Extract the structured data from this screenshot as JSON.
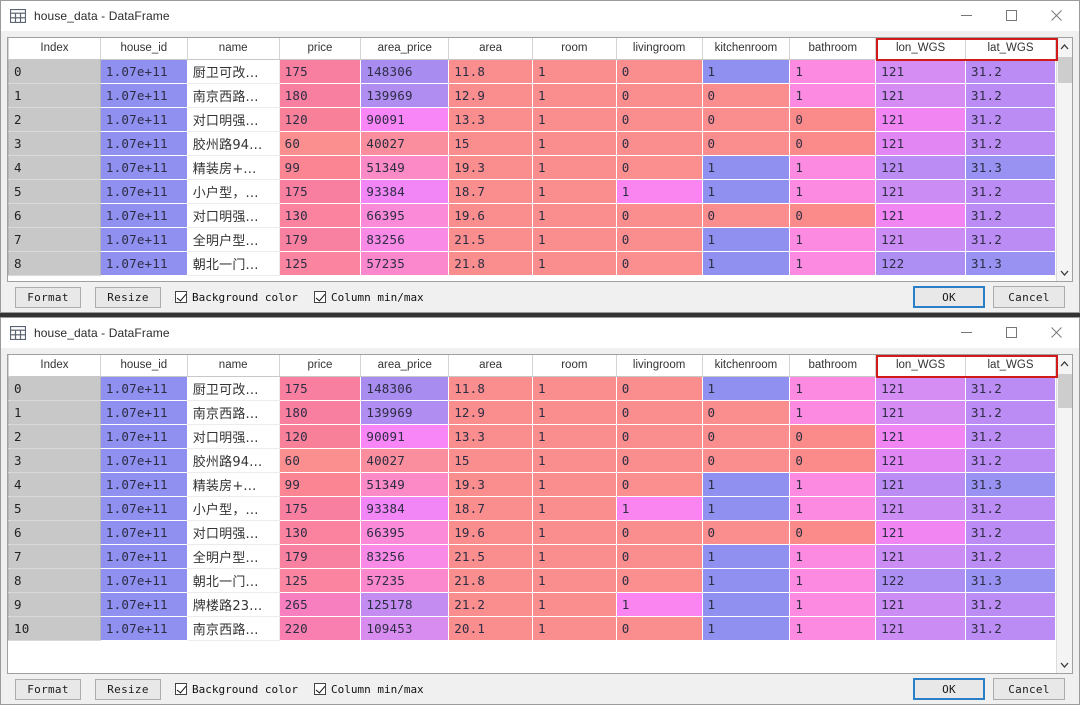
{
  "window": {
    "title": "house_data - DataFrame",
    "icon": "table-icon",
    "controls": {
      "minimize": "—",
      "maximize": "□",
      "close": "✕"
    }
  },
  "footer": {
    "format_label": "Format",
    "resize_label": "Resize",
    "background_color_label": "Background color",
    "column_minmax_label": "Column min/max",
    "background_color_checked": true,
    "column_minmax_checked": true,
    "ok_label": "OK",
    "cancel_label": "Cancel"
  },
  "highlight": {
    "color": "#d11b1b",
    "columns": [
      "lon_WGS",
      "lat_WGS"
    ]
  },
  "table": {
    "columns": [
      "Index",
      "house_id",
      "name",
      "price",
      "area_price",
      "area",
      "room",
      "livingroom",
      "kitchenroom",
      "bathroom",
      "lon_WGS",
      "lat_WGS"
    ],
    "rows": [
      {
        "Index": "0",
        "house_id": "1.07e+11",
        "name": "厨卫可改...",
        "price": "175",
        "area_price": "148306",
        "area": "11.8",
        "room": "1",
        "livingroom": "0",
        "kitchenroom": "1",
        "bathroom": "1",
        "lon_WGS": "121",
        "lat_WGS": "31.2",
        "colors": {
          "house_id": "#8f90f0",
          "price": "#f87fa0",
          "area_price": "#a88cf0",
          "area": "#fa8d8d",
          "room": "#fa8d8d",
          "livingroom": "#fa8d8d",
          "kitchenroom": "#8f90f0",
          "bathroom": "#fb8ae0",
          "lon_WGS": "#d58cf3",
          "lat_WGS": "#bb8cf3"
        }
      },
      {
        "Index": "1",
        "house_id": "1.07e+11",
        "name": "南京西路...",
        "price": "180",
        "area_price": "139969",
        "area": "12.9",
        "room": "1",
        "livingroom": "0",
        "kitchenroom": "0",
        "bathroom": "1",
        "lon_WGS": "121",
        "lat_WGS": "31.2",
        "colors": {
          "house_id": "#8f90f0",
          "price": "#f87fa0",
          "area_price": "#b08df0",
          "area": "#fa8d8d",
          "room": "#fa8d8d",
          "livingroom": "#fa8d8d",
          "kitchenroom": "#fa8d8d",
          "bathroom": "#fb8ae0",
          "lon_WGS": "#d58cf3",
          "lat_WGS": "#bb8cf3"
        }
      },
      {
        "Index": "2",
        "house_id": "1.07e+11",
        "name": "对口明强...",
        "price": "120",
        "area_price": "90091",
        "area": "13.3",
        "room": "1",
        "livingroom": "0",
        "kitchenroom": "0",
        "bathroom": "0",
        "lon_WGS": "121",
        "lat_WGS": "31.2",
        "colors": {
          "house_id": "#8f90f0",
          "price": "#f98099",
          "area_price": "#f986f6",
          "area": "#fa8d8d",
          "room": "#fa8d8d",
          "livingroom": "#fa8d8d",
          "kitchenroom": "#fa8d8d",
          "bathroom": "#fb8a8a",
          "lon_WGS": "#f186f3",
          "lat_WGS": "#bb8cf3"
        }
      },
      {
        "Index": "3",
        "house_id": "1.07e+11",
        "name": "胶州路94...",
        "price": "60",
        "area_price": "40027",
        "area": "15",
        "room": "1",
        "livingroom": "0",
        "kitchenroom": "0",
        "bathroom": "0",
        "lon_WGS": "121",
        "lat_WGS": "31.2",
        "colors": {
          "house_id": "#8f90f0",
          "price": "#fb8e8e",
          "area_price": "#fb8e9e",
          "area": "#fa8d8d",
          "room": "#fa8d8d",
          "livingroom": "#fa8d8d",
          "kitchenroom": "#fa8d8d",
          "bathroom": "#fb8a8a",
          "lon_WGS": "#e186f3",
          "lat_WGS": "#bb8cf3"
        }
      },
      {
        "Index": "4",
        "house_id": "1.07e+11",
        "name": "精装房+...",
        "price": "99",
        "area_price": "51349",
        "area": "19.3",
        "room": "1",
        "livingroom": "0",
        "kitchenroom": "1",
        "bathroom": "1",
        "lon_WGS": "121",
        "lat_WGS": "31.3",
        "colors": {
          "house_id": "#8f90f0",
          "price": "#fb8593",
          "area_price": "#fb8ac6",
          "area": "#fa8d8d",
          "room": "#fa8d8d",
          "livingroom": "#fb8f8f",
          "kitchenroom": "#8f90f0",
          "bathroom": "#fb8ae0",
          "lon_WGS": "#bb8cf3",
          "lat_WGS": "#9a92f3"
        }
      },
      {
        "Index": "5",
        "house_id": "1.07e+11",
        "name": "小户型，...",
        "price": "175",
        "area_price": "93384",
        "area": "18.7",
        "room": "1",
        "livingroom": "1",
        "kitchenroom": "1",
        "bathroom": "1",
        "lon_WGS": "121",
        "lat_WGS": "31.2",
        "colors": {
          "house_id": "#8f90f0",
          "price": "#f87fa0",
          "area_price": "#f286f6",
          "area": "#fa8d8d",
          "room": "#fa8d8d",
          "livingroom": "#fb85f0",
          "kitchenroom": "#8f90f0",
          "bathroom": "#fb8ae0",
          "lon_WGS": "#cb8cf3",
          "lat_WGS": "#bb8cf3"
        }
      },
      {
        "Index": "6",
        "house_id": "1.07e+11",
        "name": "对口明强...",
        "price": "130",
        "area_price": "66395",
        "area": "19.6",
        "room": "1",
        "livingroom": "0",
        "kitchenroom": "0",
        "bathroom": "0",
        "lon_WGS": "121",
        "lat_WGS": "31.2",
        "colors": {
          "house_id": "#8f90f0",
          "price": "#fb83a0",
          "area_price": "#fb8ad8",
          "area": "#fa8d8d",
          "room": "#fa8d8d",
          "livingroom": "#fa8d8d",
          "kitchenroom": "#fa8d8d",
          "bathroom": "#fb8a8a",
          "lon_WGS": "#f186f3",
          "lat_WGS": "#bb8cf3"
        }
      },
      {
        "Index": "7",
        "house_id": "1.07e+11",
        "name": "全明户型...",
        "price": "179",
        "area_price": "83256",
        "area": "21.5",
        "room": "1",
        "livingroom": "0",
        "kitchenroom": "1",
        "bathroom": "1",
        "lon_WGS": "121",
        "lat_WGS": "31.2",
        "colors": {
          "house_id": "#8f90f0",
          "price": "#f880a0",
          "area_price": "#f98ae6",
          "area": "#fa8d8d",
          "room": "#fa8d8d",
          "livingroom": "#fa8d8d",
          "kitchenroom": "#8f90f0",
          "bathroom": "#fb8ae0",
          "lon_WGS": "#cb8cf3",
          "lat_WGS": "#bb8cf3"
        }
      },
      {
        "Index": "8",
        "house_id": "1.07e+11",
        "name": "朝北一门...",
        "price": "125",
        "area_price": "57235",
        "area": "21.8",
        "room": "1",
        "livingroom": "0",
        "kitchenroom": "1",
        "bathroom": "1",
        "lon_WGS": "122",
        "lat_WGS": "31.3",
        "colors": {
          "house_id": "#8f90f0",
          "price": "#fb84a0",
          "area_price": "#fb88cc",
          "area": "#fa8d8d",
          "room": "#fa8d8d",
          "livingroom": "#fb8f8f",
          "kitchenroom": "#8f90f0",
          "bathroom": "#fb8ae0",
          "lon_WGS": "#ad8ef3",
          "lat_WGS": "#9a92f3"
        }
      },
      {
        "Index": "9",
        "house_id": "1.07e+11",
        "name": "牌楼路23...",
        "price": "265",
        "area_price": "125178",
        "area": "21.2",
        "room": "1",
        "livingroom": "1",
        "kitchenroom": "1",
        "bathroom": "1",
        "lon_WGS": "121",
        "lat_WGS": "31.2",
        "colors": {
          "house_id": "#8f90f0",
          "price": "#f77fc0",
          "area_price": "#c48cf0",
          "area": "#fa8d8d",
          "room": "#fa8d8d",
          "livingroom": "#fb85f0",
          "kitchenroom": "#8f90f0",
          "bathroom": "#fb8ae0",
          "lon_WGS": "#cb8cf3",
          "lat_WGS": "#bb8cf3"
        }
      },
      {
        "Index": "10",
        "house_id": "1.07e+11",
        "name": "南京西路...",
        "price": "220",
        "area_price": "109453",
        "area": "20.1",
        "room": "1",
        "livingroom": "0",
        "kitchenroom": "1",
        "bathroom": "1",
        "lon_WGS": "121",
        "lat_WGS": "31.2",
        "colors": {
          "house_id": "#8f90f0",
          "price": "#f87fb0",
          "area_price": "#d98cf0",
          "area": "#fa8d8d",
          "room": "#fa8d8d",
          "livingroom": "#fa8d8d",
          "kitchenroom": "#8f90f0",
          "bathroom": "#fb8ae0",
          "lon_WGS": "#cb8cf3",
          "lat_WGS": "#bb8cf3"
        }
      }
    ]
  },
  "top_window_visible_rows": 9,
  "bottom_window_visible_rows": 11
}
